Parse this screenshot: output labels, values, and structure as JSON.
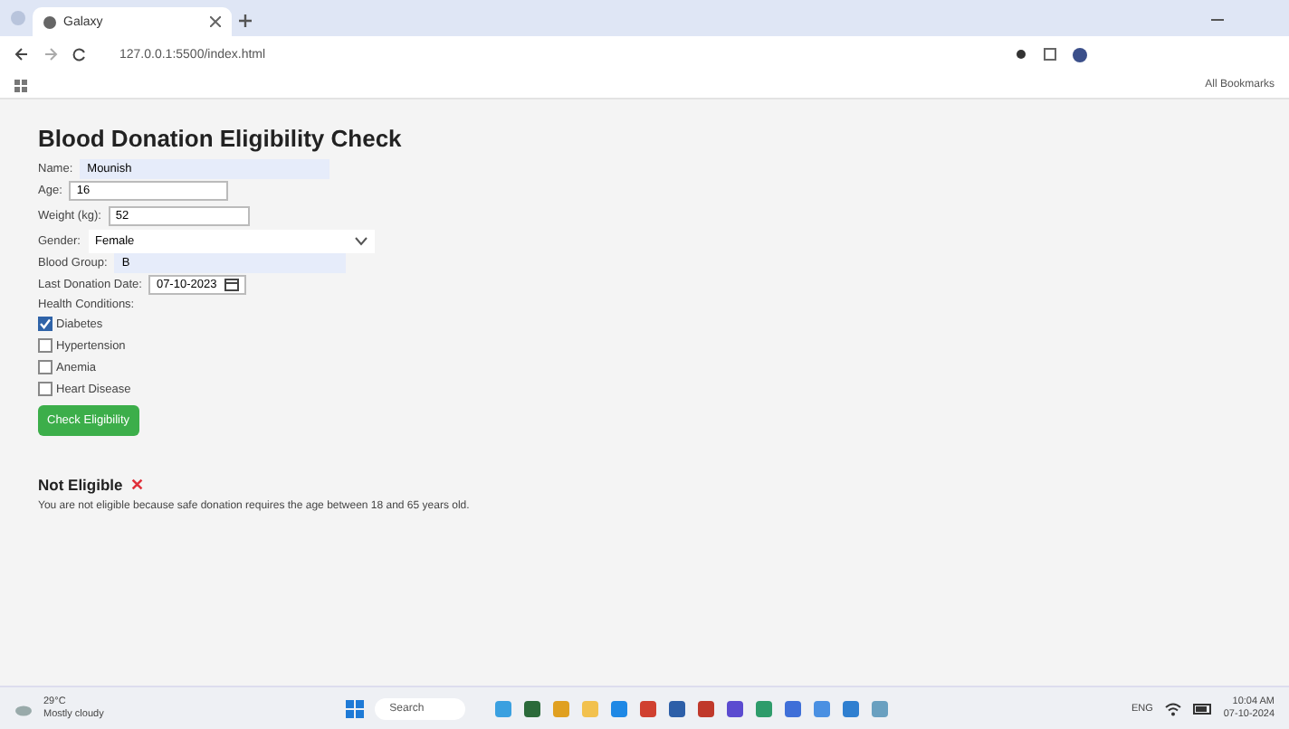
{
  "browser": {
    "tab_title": "Galaxy",
    "address": "127.0.0.1:5500/index.html",
    "bookmarks_label": "All Bookmarks"
  },
  "form": {
    "title": "Blood Donation Eligibility Check",
    "fields": [
      {
        "kind": "text",
        "label": "Name:",
        "value": "Mounish",
        "highlighted": true
      },
      {
        "kind": "text",
        "label": "Age:",
        "value": "16",
        "highlighted": false
      },
      {
        "kind": "text",
        "label": "Weight (kg):",
        "value": "52",
        "highlighted": false
      },
      {
        "kind": "select",
        "label": "Gender:",
        "value": "Female",
        "highlighted": false
      },
      {
        "kind": "text",
        "label": "Blood Group:",
        "value": "B",
        "highlighted": true
      },
      {
        "kind": "date",
        "label": "Last Donation Date:",
        "value": "07-10-2023",
        "highlighted": false
      }
    ],
    "conditions_label": "Health Conditions:",
    "conditions": [
      {
        "label": "Diabetes",
        "checked": true
      },
      {
        "label": "Hypertension",
        "checked": false
      },
      {
        "label": "Anemia",
        "checked": false
      },
      {
        "label": "Heart Disease",
        "checked": false
      }
    ],
    "button": "Check Eligibility"
  },
  "result": {
    "title": "Not Eligible",
    "mark": "✕",
    "message": "You are not eligible because safe donation requires the age between 18 and 65 years old."
  },
  "taskbar": {
    "weather": "29°C",
    "weather_sub": "Mostly cloudy",
    "search": "Search",
    "lang": "ENG",
    "time": "10:04 AM",
    "date": "07-10-2024"
  }
}
